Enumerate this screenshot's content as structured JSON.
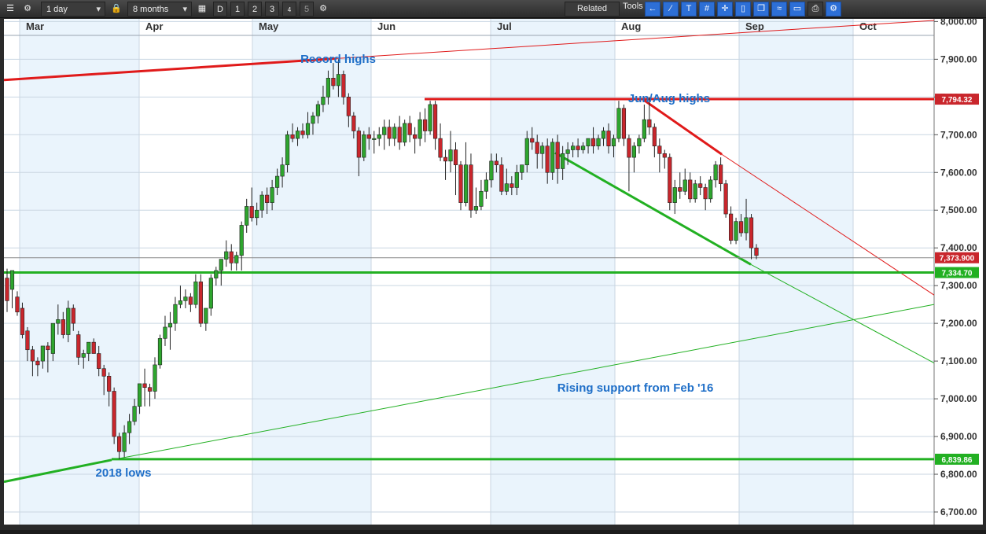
{
  "toolbar": {
    "interval": "1 day",
    "range": "8 months",
    "buttons": [
      "D",
      "1",
      "2",
      "3",
      "4",
      "5"
    ],
    "related_label": "Related",
    "tools_label": "Tools",
    "icons": [
      "menu-icon",
      "gear-icon",
      "lock-icon",
      "calendar-icon",
      "settings-icon",
      "back-arrow-icon",
      "curve-tool-icon",
      "text-tool-icon",
      "hash-tool-icon",
      "crosshair-tool-icon",
      "candle-tool-icon",
      "window-tool-icon",
      "fibonacci-tool-icon",
      "eraser-tool-icon",
      "print-icon",
      "gear-blue-icon"
    ]
  },
  "colors": {
    "background": "#ffffff",
    "shade": "#eaf4fc",
    "grid": "#c9d6e2",
    "up": "#2ea52e",
    "down": "#c9262c",
    "support": "#22b022",
    "resistance": "#e01a1a",
    "annotation": "#1f6fc8"
  },
  "chart_data": {
    "type": "candlestick",
    "x_axis": {
      "labels": [
        "Mar",
        "Apr",
        "May",
        "Jun",
        "Jul",
        "Aug",
        "Sep",
        "Oct"
      ]
    },
    "y_axis": {
      "ticks": [
        "6,700.00",
        "6,800.00",
        "6,900.00",
        "7,000.00",
        "7,100.00",
        "7,200.00",
        "7,300.00",
        "7,400.00",
        "7,500.00",
        "7,600.00",
        "7,700.00",
        "7,800.00",
        "7,900.00",
        "8,000.00"
      ],
      "range": [
        6680,
        8010
      ]
    },
    "price_tags": [
      {
        "label": "7,794.32",
        "value": 7794.32,
        "color": "#c9262c"
      },
      {
        "label": "7,373.900",
        "value": 7373.9,
        "color": "#c9262c"
      },
      {
        "label": "7,334.70",
        "value": 7334.7,
        "color": "#22b022"
      },
      {
        "label": "6,839.86",
        "value": 6839.86,
        "color": "#22b022"
      }
    ],
    "candles": [
      [
        7320,
        7345,
        7260,
        7230
      ],
      [
        7290,
        7310,
        7340,
        7240
      ],
      [
        7270,
        7285,
        7230,
        7220
      ],
      [
        7240,
        7255,
        7170,
        7160
      ],
      [
        7180,
        7190,
        7130,
        7100
      ],
      [
        7130,
        7140,
        7100,
        7060
      ],
      [
        7100,
        7110,
        7090,
        7060
      ],
      [
        7100,
        7120,
        7140,
        7080
      ],
      [
        7140,
        7150,
        7130,
        7070
      ],
      [
        7120,
        7140,
        7200,
        7100
      ],
      [
        7200,
        7250,
        7210,
        7170
      ],
      [
        7210,
        7230,
        7170,
        7160
      ],
      [
        7170,
        7260,
        7240,
        7150
      ],
      [
        7240,
        7250,
        7200,
        7180
      ],
      [
        7170,
        7180,
        7110,
        7090
      ],
      [
        7110,
        7130,
        7120,
        7080
      ],
      [
        7120,
        7130,
        7150,
        7100
      ],
      [
        7150,
        7160,
        7120,
        7120
      ],
      [
        7120,
        7140,
        7080,
        7060
      ],
      [
        7080,
        7090,
        7060,
        7010
      ],
      [
        7060,
        7070,
        7020,
        6980
      ],
      [
        7020,
        7030,
        6900,
        6880
      ],
      [
        6900,
        6910,
        6860,
        6840
      ],
      [
        6860,
        6930,
        6910,
        6845
      ],
      [
        6910,
        6960,
        6940,
        6880
      ],
      [
        6940,
        7000,
        6980,
        6930
      ],
      [
        6980,
        7030,
        7040,
        6960
      ],
      [
        7040,
        7080,
        7030,
        6980
      ],
      [
        7030,
        7040,
        7020,
        6980
      ],
      [
        7020,
        7110,
        7090,
        7000
      ],
      [
        7090,
        7170,
        7160,
        7080
      ],
      [
        7160,
        7220,
        7190,
        7140
      ],
      [
        7190,
        7230,
        7200,
        7130
      ],
      [
        7200,
        7270,
        7250,
        7180
      ],
      [
        7250,
        7300,
        7260,
        7240
      ],
      [
        7260,
        7290,
        7270,
        7240
      ],
      [
        7270,
        7280,
        7250,
        7230
      ],
      [
        7250,
        7330,
        7310,
        7240
      ],
      [
        7310,
        7330,
        7200,
        7190
      ],
      [
        7200,
        7240,
        7240,
        7180
      ],
      [
        7240,
        7330,
        7320,
        7220
      ],
      [
        7320,
        7350,
        7340,
        7300
      ],
      [
        7340,
        7370,
        7370,
        7300
      ],
      [
        7370,
        7420,
        7390,
        7350
      ],
      [
        7390,
        7410,
        7360,
        7340
      ],
      [
        7360,
        7390,
        7380,
        7340
      ],
      [
        7380,
        7470,
        7460,
        7340
      ],
      [
        7460,
        7530,
        7510,
        7440
      ],
      [
        7510,
        7560,
        7480,
        7470
      ],
      [
        7480,
        7520,
        7500,
        7460
      ],
      [
        7500,
        7550,
        7540,
        7480
      ],
      [
        7540,
        7560,
        7520,
        7490
      ],
      [
        7520,
        7580,
        7560,
        7500
      ],
      [
        7560,
        7610,
        7590,
        7540
      ],
      [
        7590,
        7640,
        7620,
        7560
      ],
      [
        7620,
        7710,
        7700,
        7600
      ],
      [
        7700,
        7730,
        7690,
        7680
      ],
      [
        7690,
        7720,
        7710,
        7670
      ],
      [
        7710,
        7730,
        7700,
        7690
      ],
      [
        7700,
        7760,
        7730,
        7690
      ],
      [
        7730,
        7760,
        7750,
        7700
      ],
      [
        7750,
        7790,
        7780,
        7730
      ],
      [
        7780,
        7830,
        7800,
        7760
      ],
      [
        7800,
        7870,
        7850,
        7780
      ],
      [
        7850,
        7890,
        7830,
        7820
      ],
      [
        7830,
        7900,
        7860,
        7800
      ],
      [
        7860,
        7870,
        7800,
        7780
      ],
      [
        7800,
        7810,
        7750,
        7720
      ],
      [
        7750,
        7760,
        7710,
        7690
      ],
      [
        7710,
        7720,
        7640,
        7590
      ],
      [
        7640,
        7710,
        7700,
        7630
      ],
      [
        7700,
        7720,
        7690,
        7660
      ],
      [
        7690,
        7710,
        7690,
        7650
      ],
      [
        7690,
        7720,
        7700,
        7670
      ],
      [
        7700,
        7740,
        7720,
        7660
      ],
      [
        7720,
        7740,
        7690,
        7670
      ],
      [
        7690,
        7730,
        7720,
        7670
      ],
      [
        7720,
        7750,
        7680,
        7660
      ],
      [
        7680,
        7740,
        7730,
        7670
      ],
      [
        7730,
        7750,
        7700,
        7680
      ],
      [
        7700,
        7720,
        7690,
        7650
      ],
      [
        7690,
        7760,
        7740,
        7670
      ],
      [
        7740,
        7770,
        7710,
        7680
      ],
      [
        7710,
        7790,
        7780,
        7700
      ],
      [
        7780,
        7790,
        7690,
        7660
      ],
      [
        7690,
        7730,
        7640,
        7630
      ],
      [
        7640,
        7660,
        7630,
        7580
      ],
      [
        7630,
        7710,
        7660,
        7600
      ],
      [
        7660,
        7680,
        7620,
        7540
      ],
      [
        7620,
        7630,
        7520,
        7500
      ],
      [
        7520,
        7680,
        7620,
        7510
      ],
      [
        7620,
        7650,
        7500,
        7480
      ],
      [
        7500,
        7560,
        7510,
        7490
      ],
      [
        7510,
        7580,
        7550,
        7500
      ],
      [
        7550,
        7600,
        7580,
        7530
      ],
      [
        7580,
        7650,
        7630,
        7560
      ],
      [
        7630,
        7650,
        7620,
        7600
      ],
      [
        7620,
        7640,
        7550,
        7540
      ],
      [
        7550,
        7610,
        7570,
        7540
      ],
      [
        7570,
        7590,
        7560,
        7540
      ],
      [
        7560,
        7620,
        7600,
        7540
      ],
      [
        7600,
        7620,
        7620,
        7580
      ],
      [
        7620,
        7710,
        7690,
        7600
      ],
      [
        7690,
        7720,
        7680,
        7660
      ],
      [
        7680,
        7700,
        7650,
        7610
      ],
      [
        7650,
        7680,
        7670,
        7610
      ],
      [
        7670,
        7690,
        7600,
        7570
      ],
      [
        7600,
        7690,
        7680,
        7580
      ],
      [
        7680,
        7700,
        7610,
        7570
      ],
      [
        7610,
        7670,
        7650,
        7580
      ],
      [
        7650,
        7680,
        7660,
        7620
      ],
      [
        7660,
        7680,
        7670,
        7640
      ],
      [
        7670,
        7690,
        7660,
        7640
      ],
      [
        7660,
        7680,
        7670,
        7650
      ],
      [
        7670,
        7690,
        7690,
        7650
      ],
      [
        7690,
        7720,
        7670,
        7650
      ],
      [
        7670,
        7700,
        7690,
        7660
      ],
      [
        7690,
        7720,
        7710,
        7670
      ],
      [
        7710,
        7730,
        7670,
        7650
      ],
      [
        7670,
        7700,
        7690,
        7640
      ],
      [
        7690,
        7790,
        7770,
        7680
      ],
      [
        7770,
        7780,
        7690,
        7670
      ],
      [
        7690,
        7700,
        7640,
        7550
      ],
      [
        7640,
        7680,
        7670,
        7600
      ],
      [
        7670,
        7700,
        7690,
        7650
      ],
      [
        7690,
        7780,
        7740,
        7680
      ],
      [
        7740,
        7800,
        7720,
        7700
      ],
      [
        7720,
        7730,
        7670,
        7640
      ],
      [
        7670,
        7690,
        7650,
        7600
      ],
      [
        7650,
        7660,
        7640,
        7610
      ],
      [
        7640,
        7650,
        7520,
        7500
      ],
      [
        7520,
        7580,
        7560,
        7490
      ],
      [
        7560,
        7600,
        7550,
        7530
      ],
      [
        7550,
        7610,
        7580,
        7540
      ],
      [
        7580,
        7600,
        7530,
        7520
      ],
      [
        7530,
        7580,
        7570,
        7520
      ],
      [
        7570,
        7590,
        7560,
        7540
      ],
      [
        7560,
        7570,
        7530,
        7500
      ],
      [
        7530,
        7590,
        7580,
        7520
      ],
      [
        7580,
        7630,
        7620,
        7560
      ],
      [
        7620,
        7640,
        7570,
        7550
      ],
      [
        7570,
        7580,
        7490,
        7480
      ],
      [
        7490,
        7510,
        7420,
        7410
      ],
      [
        7420,
        7480,
        7470,
        7410
      ],
      [
        7470,
        7490,
        7440,
        7430
      ],
      [
        7440,
        7530,
        7480,
        7420
      ],
      [
        7480,
        7490,
        7400,
        7370
      ],
      [
        7400,
        7410,
        7380,
        7370
      ]
    ],
    "trendlines": [
      {
        "name": "record-highs-line",
        "from": [
          "start",
          7845
        ],
        "to": [
          "Oct-end",
          8005
        ]
      },
      {
        "name": "jun-aug-highs-line",
        "value": 7794.32
      },
      {
        "name": "down-resistance-line",
        "from": [
          "Aug",
          7793
        ],
        "to": [
          "end",
          7275
        ]
      },
      {
        "name": "down-support-line",
        "from": [
          "Jul",
          7650
        ],
        "to": [
          "end",
          7095
        ]
      },
      {
        "name": "rising-support-line",
        "from": [
          "start",
          6780
        ],
        "to": [
          "end",
          7250
        ]
      },
      {
        "name": "support-7334",
        "value": 7334.7
      },
      {
        "name": "support-6839",
        "value": 6839.86
      }
    ],
    "annotations": [
      "Record highs",
      "Jun/Aug highs",
      "Rising support from Feb '16",
      "2018 lows"
    ]
  }
}
